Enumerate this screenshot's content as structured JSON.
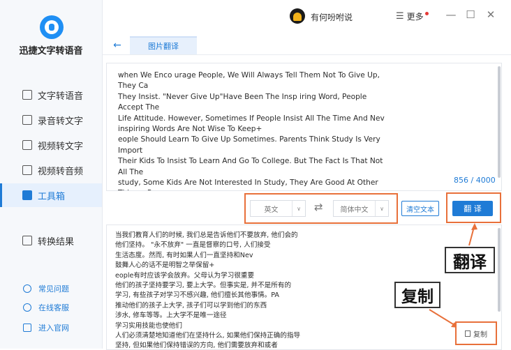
{
  "app": {
    "title": "迅捷文字转语音"
  },
  "sidebar": {
    "items": [
      {
        "label": "文字转语音",
        "icon": "text-to-speech-icon",
        "active": false
      },
      {
        "label": "录音转文字",
        "icon": "recording-icon",
        "active": false
      },
      {
        "label": "视频转文字",
        "icon": "video-icon",
        "active": false
      },
      {
        "label": "视频转音频",
        "icon": "video-audio-icon",
        "active": false
      },
      {
        "label": "工具箱",
        "icon": "toolbox-icon",
        "active": true
      },
      {
        "label": "转换结果",
        "icon": "result-icon",
        "active": false
      }
    ],
    "footer": [
      {
        "label": "常见问题",
        "icon": "help-icon"
      },
      {
        "label": "在线客服",
        "icon": "headset-icon"
      },
      {
        "label": "进入官网",
        "icon": "website-icon"
      }
    ]
  },
  "topbar": {
    "user_name": "有何吩咐说",
    "more_label": "更多",
    "icons": [
      "avatar",
      "menu-icon",
      "minimize-icon",
      "maximize-icon",
      "close-icon"
    ]
  },
  "tabs": [
    {
      "label": "图片翻译",
      "active": true
    }
  ],
  "source": {
    "text": "when We Enco urage People, We Will Always Tell Them Not To Give Up, They Ca\nThey Insist. \"Never Give Up\"Have Been The Insp iring Word, People Accept The\nLife Attitude. However, Sometimes If People Insist All The Time And Nev\ninspiring Words Are Not Wise To Keep+\neople Should Learn To Give Up Sometimes. Parents Think Study Is Very Import\nTheir Kids To Insist To Learn And Go To College. But The Fact Is That Not All The\nstudy, Some Kids Are Not Interested In Study, They Are Good At Other Things. Pa\nPush Their Children To Go To College, The Kids Can Learn The Things They\nooking, A mending Cars And So On. Going To College Is Not The Only Way\nLearning The Practical Skills Also Makes Them\nPeople Must Know Clearly What They Are Insisting, If They Keep The Right Direc\ninsist, But If They Keep The Wrong Direction, They Need To Give Up And Or",
    "counter": "856 / 4000"
  },
  "controls": {
    "source_lang": "英文",
    "target_lang": "简体中文",
    "swap_icon": "swap-icon",
    "clear_label": "清空文本",
    "translate_label": "翻 译"
  },
  "output": {
    "text": "当我们教育人们的时候, 我们总是告诉他们不要放弃, 他们会的\n他们坚持。 \"永不放弃\" 一直是督察的口号, 人们接受\n生活态度。然而, 有时如果人们一直坚持和Nev\n鼓舞人心的话不是明智之举保留+\neople有时应该学会放弃。父母认为学习很重要\n他们的孩子坚持要学习, 要上大学。但事实是, 并不是所有的\n学习, 有些孩子对学习不感兴趣, 他们擅长其他事情。PA\n推动他们的孩子上大学, 孩子们可以学到他们的东西\n涉水, 修车等等。上大学不是唯一途径\n学习实用技能也使他们\n人们必须清楚地知道他们在坚持什么, 如果他们保持正确的指导\n坚持, 但如果他们保持错误的方向, 他们需要放弃和或者",
    "copy_label": "复制"
  },
  "annotations": {
    "translate_callout": "翻译",
    "copy_callout": "复制",
    "color": "#e8703a"
  }
}
